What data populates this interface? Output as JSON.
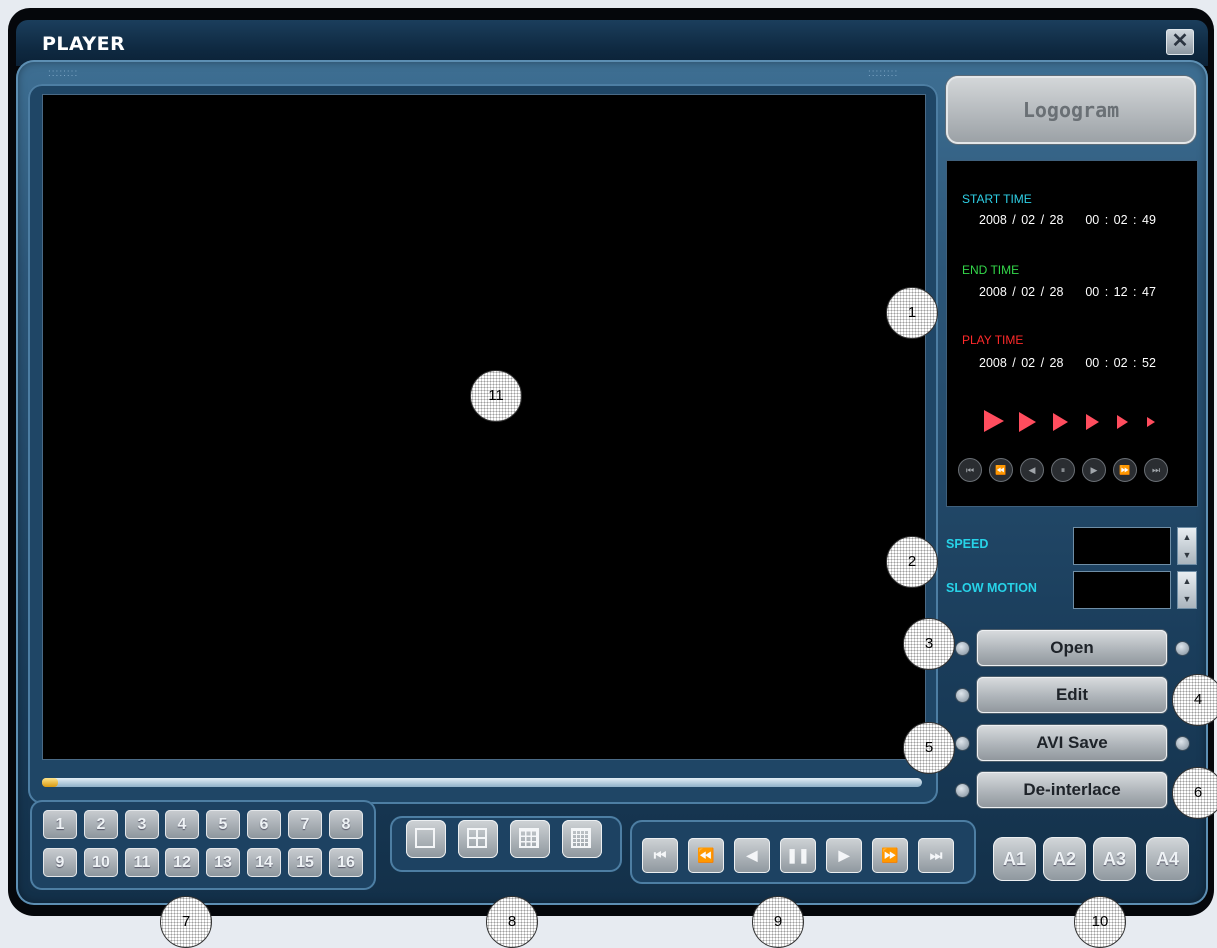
{
  "window": {
    "title": "PLAYER",
    "close_icon": "close-icon"
  },
  "logo": {
    "label": "Logogram"
  },
  "info": {
    "start_label": "START TIME",
    "start_value": "2008 / 02 / 28    00 : 02 : 49",
    "end_label": "END TIME",
    "end_value": "2008 / 02 / 28    00 : 12 : 47",
    "play_label": "PLAY TIME",
    "play_value": "2008 / 02 / 28    00 : 02 : 52",
    "label_colors": {
      "start": "#2ed0e6",
      "end": "#34d84a",
      "play": "#ff2a2a"
    }
  },
  "mini_controls": [
    "⏮",
    "⏪",
    "◀",
    "⏸",
    "▶",
    "⏩",
    "⏭"
  ],
  "speed": {
    "label": "SPEED",
    "value": ""
  },
  "slow_motion": {
    "label": "SLOW MOTION",
    "value": ""
  },
  "actions": {
    "open": "Open",
    "edit": "Edit",
    "avi_save": "AVI Save",
    "deinterlace": "De-interlace"
  },
  "channels": [
    "1",
    "2",
    "3",
    "4",
    "5",
    "6",
    "7",
    "8",
    "9",
    "10",
    "11",
    "12",
    "13",
    "14",
    "15",
    "16"
  ],
  "layouts": [
    "layout-1x1-icon",
    "layout-2x2-icon",
    "layout-3x3-icon",
    "layout-4x4-icon"
  ],
  "transport": [
    "first-icon",
    "rewind-icon",
    "reverse-play-icon",
    "pause-icon",
    "play-icon",
    "fast-forward-icon",
    "last-icon"
  ],
  "audio": [
    "A1",
    "A2",
    "A3",
    "A4"
  ],
  "progress": {
    "position": 0.02
  },
  "callouts": [
    "1",
    "2",
    "3",
    "4",
    "5",
    "6",
    "7",
    "8",
    "9",
    "10",
    "11"
  ]
}
